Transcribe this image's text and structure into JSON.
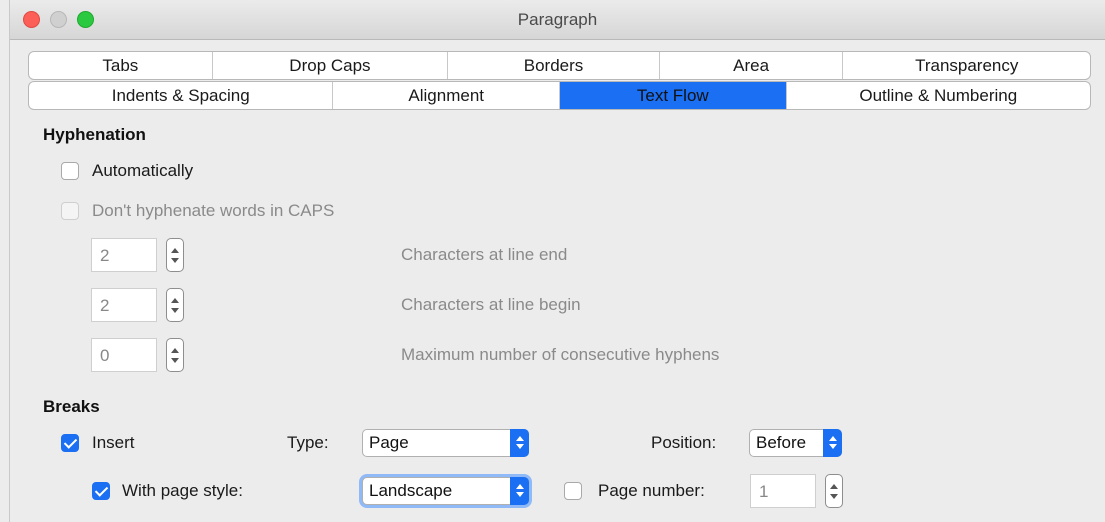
{
  "window": {
    "title": "Paragraph"
  },
  "tabs": {
    "row1": [
      "Tabs",
      "Drop Caps",
      "Borders",
      "Area",
      "Transparency"
    ],
    "row2": [
      "Indents & Spacing",
      "Alignment",
      "Text Flow",
      "Outline & Numbering"
    ],
    "active": "Text Flow"
  },
  "hyphenation": {
    "title": "Hyphenation",
    "automatically": {
      "label": "Automatically",
      "checked": false
    },
    "dont_caps": {
      "label": "Don't hyphenate words in CAPS",
      "checked": false,
      "enabled": false
    },
    "line_end": {
      "value": "2",
      "label": "Characters at line end"
    },
    "line_begin": {
      "value": "2",
      "label": "Characters at line begin"
    },
    "max_hyphens": {
      "value": "0",
      "label": "Maximum number of consecutive hyphens"
    }
  },
  "breaks": {
    "title": "Breaks",
    "insert": {
      "label": "Insert",
      "checked": true
    },
    "type": {
      "label": "Type:",
      "value": "Page"
    },
    "position": {
      "label": "Position:",
      "value": "Before"
    },
    "page_style": {
      "label": "With page style:",
      "checked": true,
      "value": "Landscape"
    },
    "page_number": {
      "label": "Page number:",
      "checked": false,
      "value": "1"
    }
  },
  "colors": {
    "accent": "#1a6ff3",
    "background": "#ececec",
    "close": "#fc5f57",
    "maximize": "#2ac940"
  }
}
